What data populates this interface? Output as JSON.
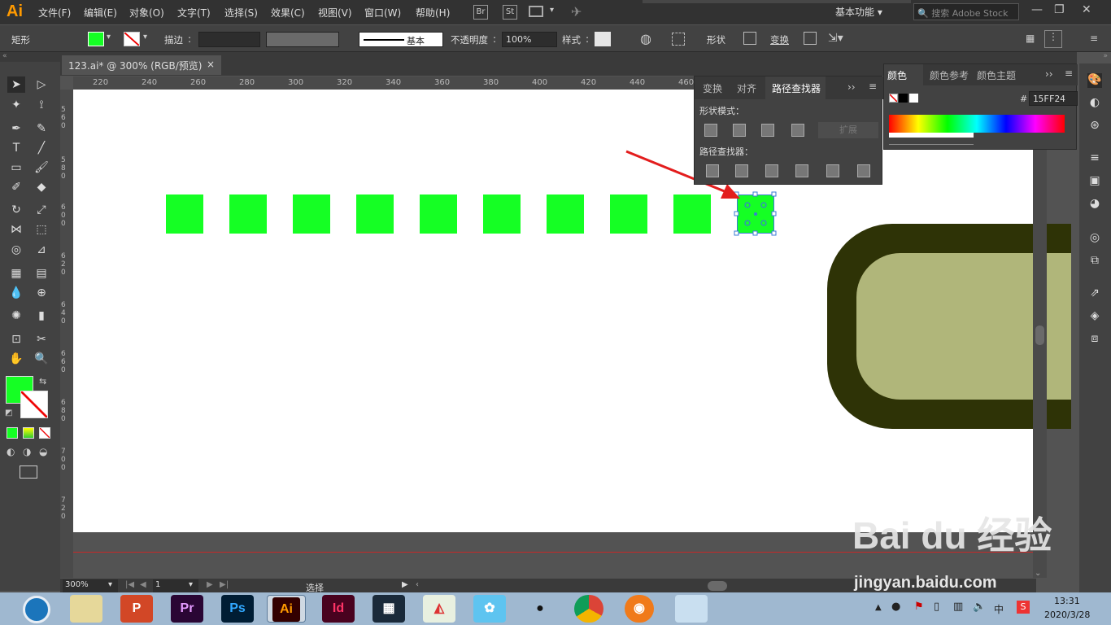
{
  "app": {
    "logo": "Ai"
  },
  "menus": [
    "文件(F)",
    "编辑(E)",
    "对象(O)",
    "文字(T)",
    "选择(S)",
    "效果(C)",
    "视图(V)",
    "窗口(W)",
    "帮助(H)"
  ],
  "menubar_tools": {
    "br": "Br",
    "st": "St"
  },
  "workspace": "基本功能",
  "search": {
    "placeholder": "搜索 Adobe Stock"
  },
  "control": {
    "object_type": "矩形",
    "stroke_label": "描边",
    "stroke_style": "基本",
    "opacity_label": "不透明度",
    "opacity_value": "100%",
    "style_label": "样式",
    "shape_label": "形状",
    "transform_label": "变换",
    "fill_color": "#15FF24"
  },
  "document": {
    "tab_title": "123.ai* @ 300% (RGB/预览)",
    "close": "×"
  },
  "ruler": {
    "h_ticks": [
      "220",
      "240",
      "260",
      "280",
      "300",
      "320",
      "340",
      "360",
      "380",
      "400",
      "420",
      "440",
      "460"
    ],
    "v_ticks": [
      "560",
      "580",
      "600",
      "620",
      "640",
      "660",
      "680",
      "700",
      "720"
    ]
  },
  "pathfinder": {
    "tabs": [
      "变换",
      "对齐",
      "路径查找器"
    ],
    "shape_modes_label": "形状模式：",
    "expand_label": "扩展",
    "pathfinders_label": "路径查找器："
  },
  "color_panel": {
    "tabs": [
      "颜色",
      "颜色参考",
      "颜色主题"
    ],
    "hex_label": "#",
    "hex_value": "15FF24"
  },
  "status": {
    "zoom": "300%",
    "artboard": "1",
    "tool_label": "选择"
  },
  "taskbar": {
    "apps": [
      "PowerPoint",
      "Pr",
      "Ps",
      "Ai",
      "Id",
      "Video",
      "Game",
      "Bird",
      "QQ",
      "Chrome",
      "Browser",
      "Notes"
    ],
    "ime": "中",
    "time": "13:31",
    "date": "2020/3/28"
  },
  "watermark": {
    "brand": "Bai du 经验",
    "url": "jingyan.baidu.com"
  },
  "colors": {
    "green": "#15FF24",
    "dark_olive": "#2e3306",
    "light_olive": "#b0b67a",
    "arrow": "#e31d1d"
  }
}
